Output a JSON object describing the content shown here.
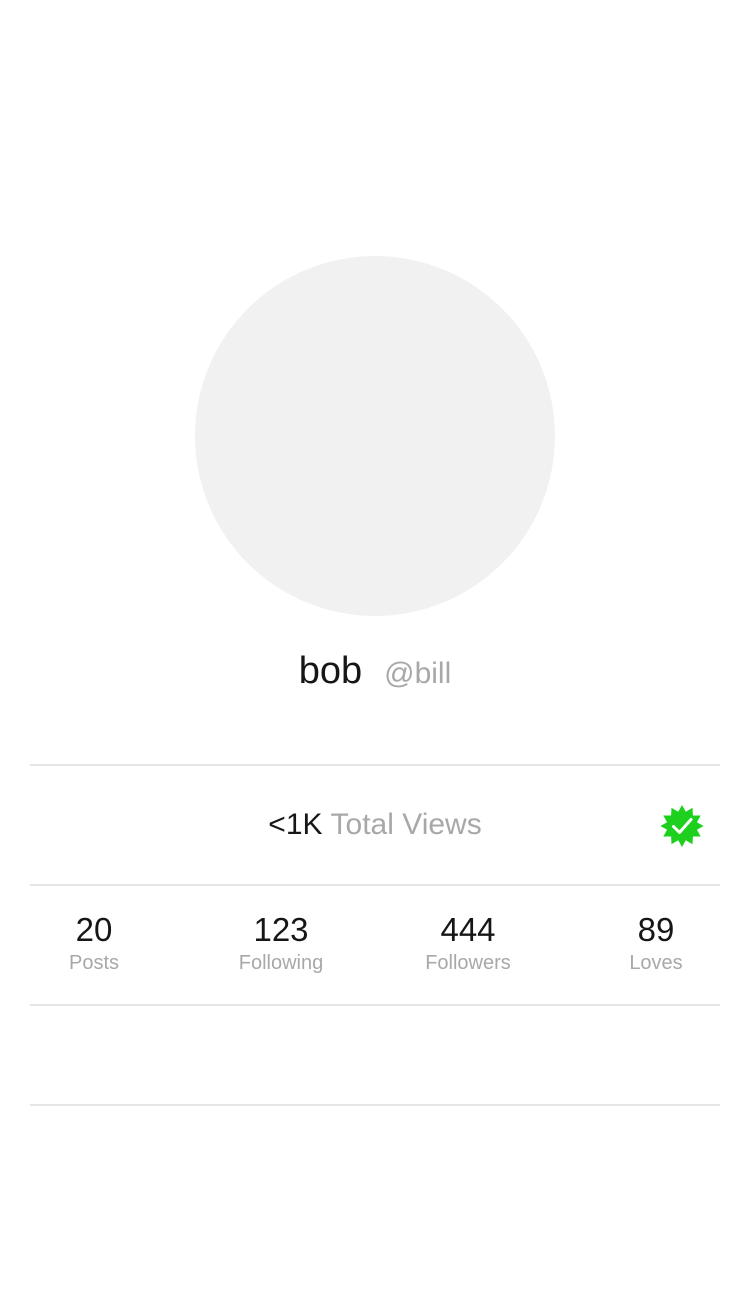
{
  "profile": {
    "display_name": "bob",
    "handle": "@bill"
  },
  "views": {
    "count": "<1K",
    "label": "Total Views",
    "verified_icon": "verified-badge-icon",
    "verified_color": "#1ed01e"
  },
  "stats": [
    {
      "value": "20",
      "label": "Posts"
    },
    {
      "value": "123",
      "label": "Following"
    },
    {
      "value": "444",
      "label": "Followers"
    },
    {
      "value": "89",
      "label": "Loves"
    }
  ],
  "colors": {
    "avatar_placeholder": "#f1f1f1",
    "muted_text": "#a8a8a8",
    "divider": "#e6e6e6"
  }
}
